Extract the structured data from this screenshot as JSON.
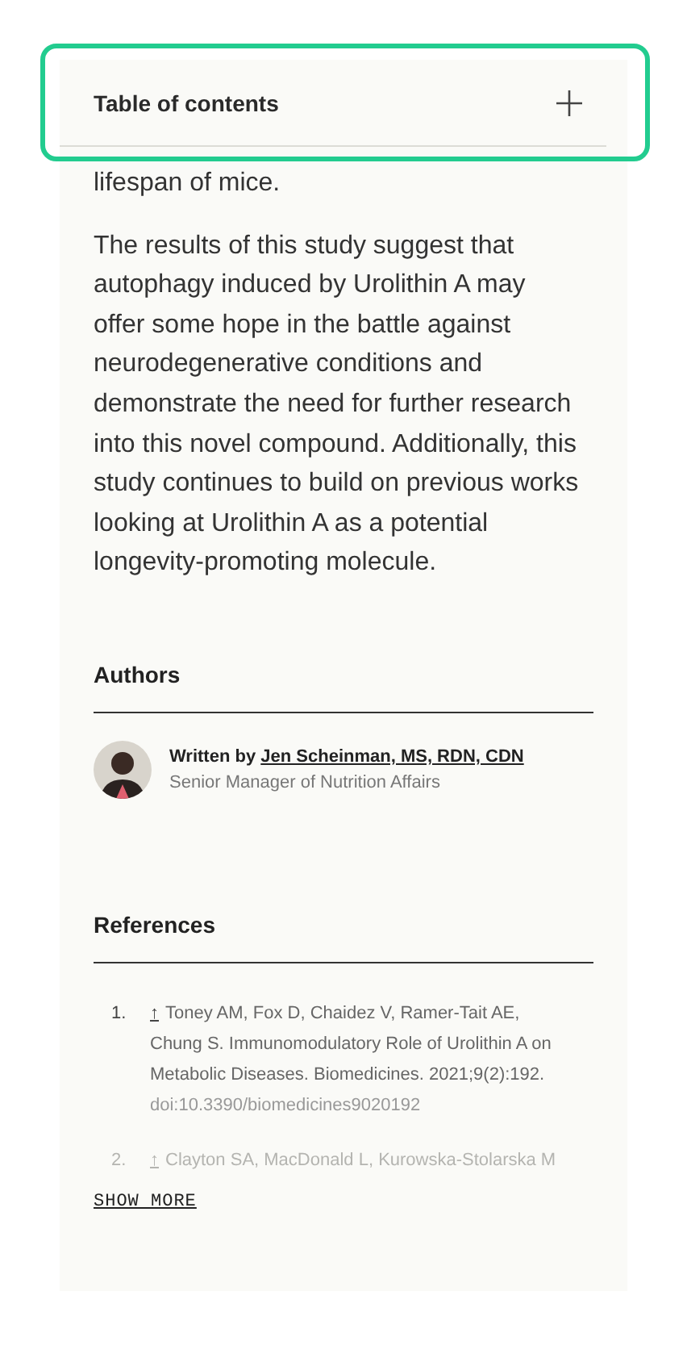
{
  "table_of_contents": {
    "title": "Table of contents",
    "expanded": false
  },
  "article": {
    "paragraphs": [
      "lifespan of mice.",
      "The results of this study suggest that autophagy induced by Urolithin A may offer some hope in the battle against neurodegenerative conditions and demonstrate the need for further research into this novel compound. Additionally, this study continues to build on previous works looking at Urolithin A as a potential longevity-promoting molecule."
    ]
  },
  "authors": {
    "heading": "Authors",
    "items": [
      {
        "prefix": "Written by",
        "name": "Jen Scheinman, MS, RDN, CDN",
        "role": "Senior Manager of Nutrition Affairs"
      }
    ]
  },
  "references": {
    "heading": "References",
    "items": [
      {
        "number": "1.",
        "arrow": "↑",
        "text": "Toney AM, Fox D, Chaidez V, Ramer-Tait AE, Chung S. Immunomodulatory Role of Urolithin A on Metabolic Diseases. Biomedicines. 2021;9(2):192.",
        "doi": "doi:10.3390/biomedicines9020192",
        "faded": false
      },
      {
        "number": "2.",
        "arrow": "↑",
        "text": "Clayton SA, MacDonald L, Kurowska-Stolarska M",
        "faded": true
      }
    ],
    "show_more": "SHOW MORE"
  }
}
